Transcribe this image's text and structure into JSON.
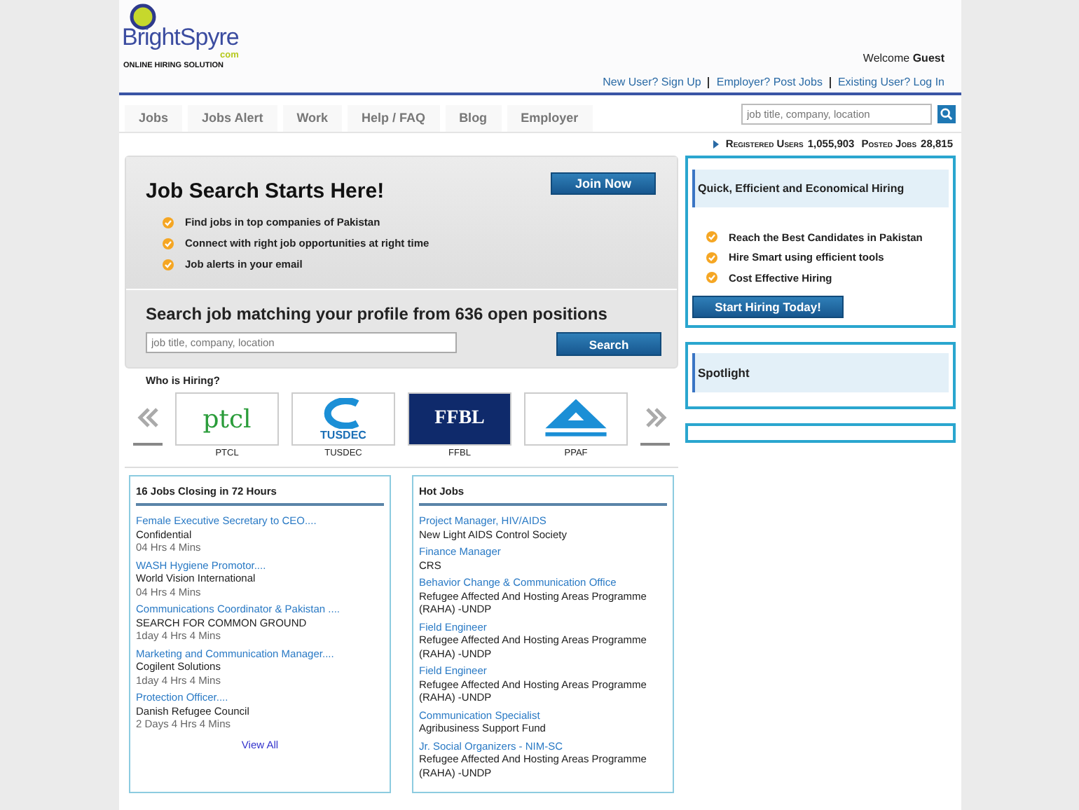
{
  "logo": {
    "name": "BrightSpyre",
    "domain": "com",
    "tagline": "ONLINE HIRING SOLUTION"
  },
  "welcome": {
    "text": "Welcome",
    "user": "Guest"
  },
  "account_links": [
    "New User? Sign Up",
    "Employer? Post Jobs",
    "Existing User? Log In"
  ],
  "nav": {
    "tabs": [
      {
        "label": "Jobs",
        "selected": false
      },
      {
        "label": "Jobs Alert",
        "selected": false
      },
      {
        "label": "Work",
        "selected": false
      },
      {
        "label": "Help / FAQ",
        "selected": false
      },
      {
        "label": "Blog",
        "selected": false
      },
      {
        "label": "Employer",
        "selected": false
      }
    ],
    "search": {
      "placeholder": "job title, company, location"
    }
  },
  "stats": {
    "registered_label": "Registered Users",
    "registered": "1,055,903",
    "posted_label": "Posted Jobs",
    "posted": "28,815"
  },
  "hero": {
    "title": "Job Search Starts Here!",
    "join_button": "Join Now",
    "bullets": [
      "Find jobs in top companies of Pakistan",
      "Connect with right job opportunities at right time",
      "Job alerts in your email"
    ],
    "search_title": "Search job matching your profile from 636 open positions",
    "search_placeholder": "job title, company, location",
    "search_button": "Search"
  },
  "hiring": {
    "title": "Who is Hiring?",
    "companies": [
      {
        "name": "PTCL",
        "kind": "ptcl",
        "logo_text": "ptcl"
      },
      {
        "name": "TUSDEC",
        "kind": "tusdec",
        "logo_text": "TUSDEC"
      },
      {
        "name": "FFBL",
        "kind": "ffbl",
        "logo_text": "FFBL"
      },
      {
        "name": "PPAF",
        "kind": "ppaf"
      }
    ]
  },
  "closing": {
    "title": "16 Jobs Closing in 72 Hours",
    "jobs": [
      {
        "title": "Female Executive Secretary to CEO....",
        "company": "Confidential",
        "time": "04 Hrs 4 Mins"
      },
      {
        "title": "WASH Hygiene Promotor....",
        "company": "World Vision International",
        "time": "04 Hrs 4 Mins"
      },
      {
        "title": "Communications Coordinator & Pakistan ....",
        "company": "SEARCH FOR COMMON GROUND",
        "time": "1day 4 Hrs 4 Mins"
      },
      {
        "title": "Marketing and Communication Manager....",
        "company": "Cogilent Solutions",
        "time": "1day 4 Hrs 4 Mins"
      },
      {
        "title": "Protection Officer....",
        "company": "Danish Refugee Council",
        "time": "2 Days 4 Hrs 4 Mins"
      }
    ],
    "view_all": "View All"
  },
  "hot": {
    "title": "Hot Jobs",
    "jobs": [
      {
        "title": "Project Manager, HIV/AIDS",
        "company": "New Light AIDS Control Society"
      },
      {
        "title": "Finance Manager",
        "company": "CRS"
      },
      {
        "title": "Behavior Change & Communication Office",
        "company": "Refugee Affected And Hosting Areas Programme (RAHA) -UNDP"
      },
      {
        "title": "Field Engineer",
        "company": "Refugee Affected And Hosting Areas Programme (RAHA) -UNDP"
      },
      {
        "title": "Field Engineer",
        "company": "Refugee Affected And Hosting Areas Programme (RAHA) -UNDP"
      },
      {
        "title": "Communication Specialist",
        "company": "Agribusiness Support Fund"
      },
      {
        "title": "Jr. Social Organizers - NIM-SC",
        "company": "Refugee Affected And Hosting Areas Programme (RAHA) -UNDP"
      }
    ]
  },
  "employer": {
    "title": "Quick, Efficient and Economical Hiring",
    "bullets": [
      "Reach the Best Candidates in Pakistan",
      "Hire Smart using efficient tools",
      "Cost Effective Hiring"
    ],
    "button": "Start Hiring Today!"
  },
  "spotlight": {
    "title": "Spotlight"
  }
}
